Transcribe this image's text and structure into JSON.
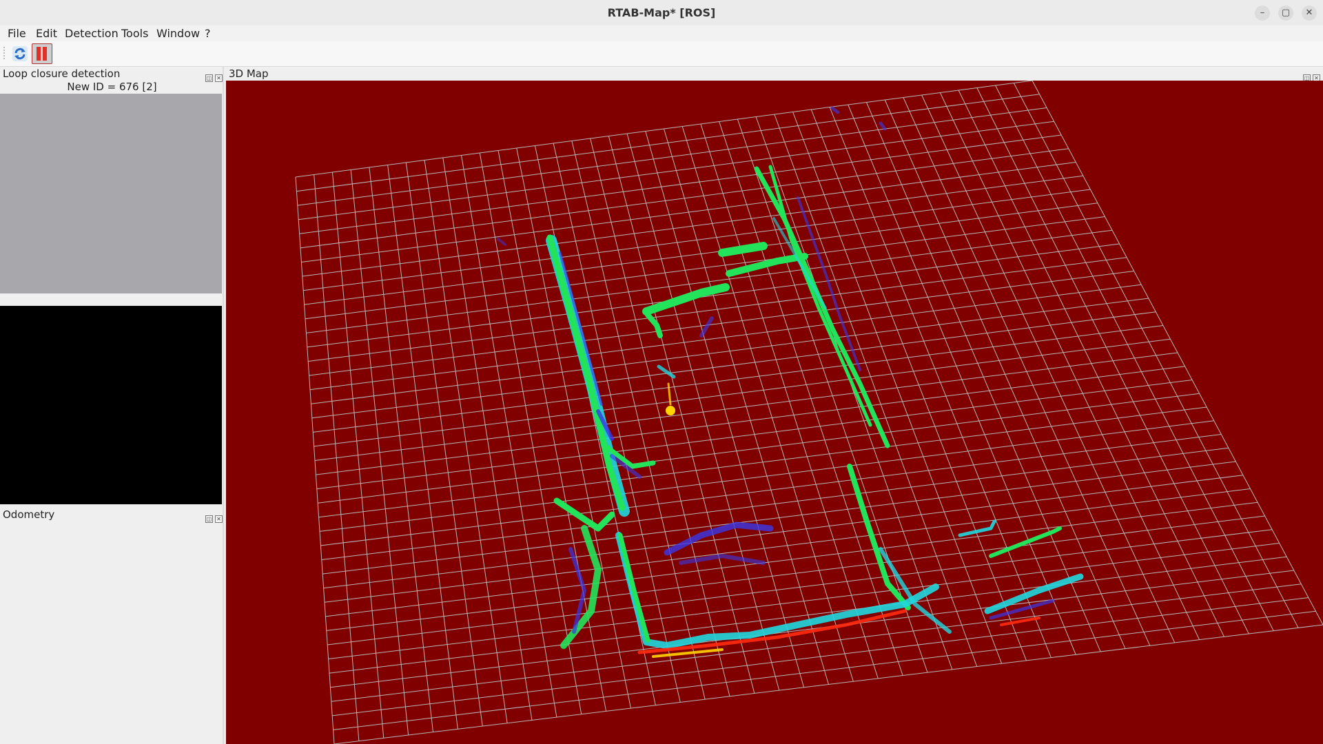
{
  "window": {
    "title": "RTAB-Map* [ROS]",
    "controls": {
      "minimize": "–",
      "maximize": "▢",
      "close": "✕"
    }
  },
  "menubar": {
    "items": [
      "File",
      "Edit",
      "Detection",
      "Tools",
      "Window",
      "?"
    ]
  },
  "toolbar": {
    "buttons": [
      {
        "name": "refresh",
        "icon": "refresh-icon"
      },
      {
        "name": "pause",
        "icon": "pause-icon"
      }
    ]
  },
  "panels": {
    "loop_closure": {
      "title": "Loop closure detection",
      "new_id": "New ID = 676 [2]"
    },
    "odometry": {
      "title": "Odometry"
    },
    "map3d": {
      "title": "3D Map"
    }
  },
  "colors": {
    "map_background": "#800000",
    "grid_lines": "#b8b8b8",
    "points_green": "#22e35a",
    "points_cyan": "#1fd8e0",
    "points_blue": "#3a38e8",
    "points_red": "#ff2a10",
    "points_yellow": "#ffd400"
  }
}
